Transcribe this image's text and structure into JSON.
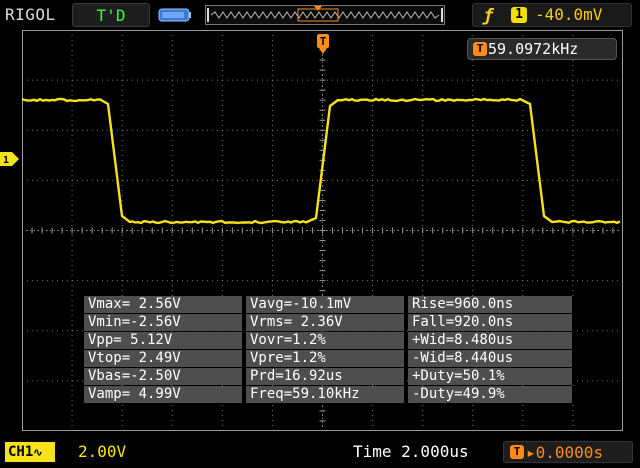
{
  "header": {
    "brand": "RIGOL",
    "trigger_status": "T'D",
    "trigger_edge_icon": "rising-edge-icon",
    "trigger_source": "1",
    "trigger_level": "-40.0mV"
  },
  "frequency_readout": "59.0972kHz",
  "trigger_marker_label": "T",
  "channel_marker_label": "1",
  "measurements": [
    [
      "Vmax= 2.56V",
      "Vavg=-10.1mV",
      "Rise=960.0ns"
    ],
    [
      "Vmin=-2.56V",
      "Vrms= 2.36V",
      "Fall=920.0ns"
    ],
    [
      "Vpp= 5.12V",
      "Vovr=1.2%",
      "+Wid=8.480us"
    ],
    [
      "Vtop= 2.49V",
      "Vpre=1.2%",
      "-Wid=8.440us"
    ],
    [
      "Vbas=-2.50V",
      "Prd=16.92us",
      "+Duty=50.1%"
    ],
    [
      "Vamp= 4.99V",
      "Freq=59.10kHz",
      "-Duty=49.9%"
    ]
  ],
  "footer": {
    "channel_label": "CH1",
    "coupling_icon": "ac-coupling-icon",
    "channel_scale": "2.00V",
    "time_label": "Time 2.000us",
    "trigger_offset": "0.0000s"
  },
  "colors": {
    "channel1": "#f5e21a",
    "trigger": "#ff8c1a",
    "grid": "#9a9a9a"
  }
}
